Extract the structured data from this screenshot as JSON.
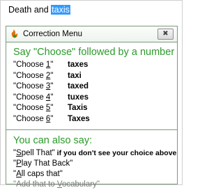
{
  "document": {
    "plain_text": "Death and ",
    "selected_text": "taxis"
  },
  "dialog": {
    "title": "Correction Menu",
    "close_label": "✖",
    "prompt": "Say \"Choose\" followed by a number",
    "choices": [
      {
        "prefix": "\"Choose ",
        "number": "1",
        "suffix": "\"",
        "word": "taxes"
      },
      {
        "prefix": "\"Choose ",
        "number": "2",
        "suffix": "\"",
        "word": "taxi"
      },
      {
        "prefix": "\"Choose ",
        "number": "3",
        "suffix": "\"",
        "word": "taxed"
      },
      {
        "prefix": "\"Choose ",
        "number": "4",
        "suffix": "\"",
        "word": "tuxes"
      },
      {
        "prefix": "\"Choose ",
        "number": "5",
        "suffix": "\"",
        "word": "Taxis"
      },
      {
        "prefix": "\"Choose ",
        "number": "6",
        "suffix": "\"",
        "word": "Taxes"
      }
    ],
    "also_heading": "You can also say:",
    "also_items": [
      {
        "quote_open": "\"",
        "underlined": "S",
        "rest": "pell That\"",
        "hint": "  if you don't see your choice above"
      },
      {
        "quote_open": "\"",
        "underlined": "P",
        "rest": "lay That Back\"",
        "hint": ""
      },
      {
        "quote_open": "\"",
        "underlined": "A",
        "rest": "ll caps that\"",
        "hint": ""
      },
      {
        "quote_open": "\"Add that to ",
        "underlined": "V",
        "rest": "ocabulary\"",
        "hint": ""
      }
    ]
  },
  "colors": {
    "accent_green": "#2a9a2a",
    "selection_blue": "#3399ff",
    "icon_orange": "#e8700a",
    "icon_green": "#2e9a2e",
    "dim_text": "#7a7a7a"
  },
  "icons": {
    "title_icon": "speech-recognition-icon",
    "close_icon": "close-icon"
  }
}
